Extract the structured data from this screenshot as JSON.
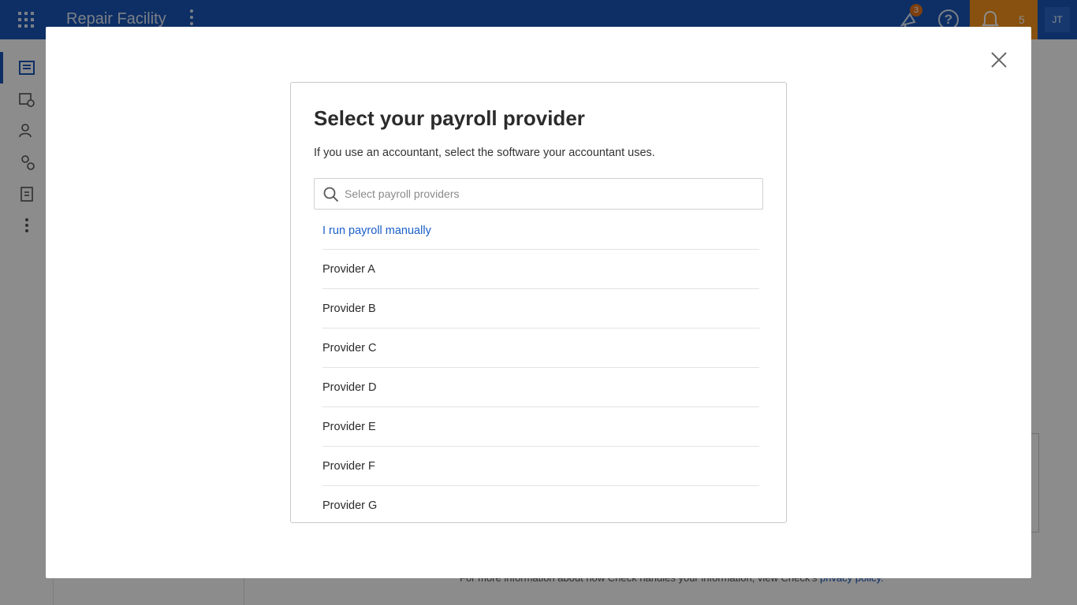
{
  "topbar": {
    "app_title": "Repair Facility",
    "announcement_count": "3",
    "notification_count": "5",
    "avatar_initials": "JT"
  },
  "background": {
    "footnote_text": "For more information about how Check handles your information, view Check's",
    "footnote_link": "privacy policy."
  },
  "modal": {
    "title": "Select your payroll provider",
    "subtitle": "If you use an accountant, select the software your accountant uses.",
    "search": {
      "placeholder": "Select payroll providers",
      "value": ""
    },
    "manual_option": "I run payroll manually",
    "providers": [
      "Provider A",
      "Provider B",
      "Provider C",
      "Provider D",
      "Provider E",
      "Provider F",
      "Provider G"
    ]
  },
  "icons": {
    "apps": "apps-grid-icon",
    "more": "more-vertical-icon",
    "announcements": "megaphone-icon",
    "help": "help-icon",
    "notifications": "bell-icon",
    "close": "close-icon",
    "search": "search-icon"
  },
  "colors": {
    "brand": "#1a56b8",
    "accent": "#f7941d",
    "link": "#1a5fc9"
  }
}
